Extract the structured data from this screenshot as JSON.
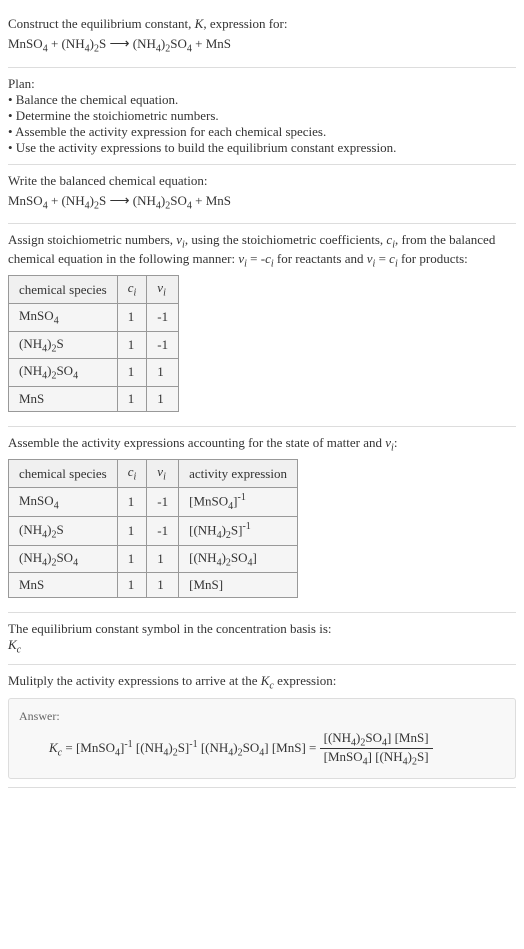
{
  "header": {
    "line1": "Construct the equilibrium constant, K, expression for:",
    "equation": "MnSO₄ + (NH₄)₂S ⟶ (NH₄)₂SO₄ + MnS"
  },
  "plan": {
    "title": "Plan:",
    "items": [
      "• Balance the chemical equation.",
      "• Determine the stoichiometric numbers.",
      "• Assemble the activity expression for each chemical species.",
      "• Use the activity expressions to build the equilibrium constant expression."
    ]
  },
  "balanced": {
    "title": "Write the balanced chemical equation:",
    "equation": "MnSO₄ + (NH₄)₂S ⟶ (NH₄)₂SO₄ + MnS"
  },
  "stoich": {
    "intro_pre": "Assign stoichiometric numbers, ",
    "intro_mid1": ", using the stoichiometric coefficients, ",
    "intro_mid2": ", from the balanced chemical equation in the following manner: ",
    "intro_reactants": " for reactants and ",
    "intro_products": " for products:",
    "table": {
      "headers": [
        "chemical species",
        "cᵢ",
        "νᵢ"
      ],
      "rows": [
        [
          "MnSO₄",
          "1",
          "-1"
        ],
        [
          "(NH₄)₂S",
          "1",
          "-1"
        ],
        [
          "(NH₄)₂SO₄",
          "1",
          "1"
        ],
        [
          "MnS",
          "1",
          "1"
        ]
      ]
    }
  },
  "activity": {
    "intro": "Assemble the activity expressions accounting for the state of matter and νᵢ:",
    "table": {
      "headers": [
        "chemical species",
        "cᵢ",
        "νᵢ",
        "activity expression"
      ],
      "rows": [
        {
          "species": "MnSO₄",
          "ci": "1",
          "vi": "-1",
          "expr": "[MnSO₄]⁻¹"
        },
        {
          "species": "(NH₄)₂S",
          "ci": "1",
          "vi": "-1",
          "expr": "[(NH₄)₂S]⁻¹"
        },
        {
          "species": "(NH₄)₂SO₄",
          "ci": "1",
          "vi": "1",
          "expr": "[(NH₄)₂SO₄]"
        },
        {
          "species": "MnS",
          "ci": "1",
          "vi": "1",
          "expr": "[MnS]"
        }
      ]
    }
  },
  "symbol": {
    "text": "The equilibrium constant symbol in the concentration basis is:",
    "sym": "K_c"
  },
  "multiply": {
    "text": "Mulitply the activity expressions to arrive at the K_c expression:"
  },
  "answer": {
    "label": "Answer:",
    "lhs": "K_c = [MnSO₄]⁻¹ [(NH₄)₂S]⁻¹ [(NH₄)₂SO₄] [MnS] = ",
    "num": "[(NH₄)₂SO₄] [MnS]",
    "den": "[MnSO₄] [(NH₄)₂S]"
  }
}
